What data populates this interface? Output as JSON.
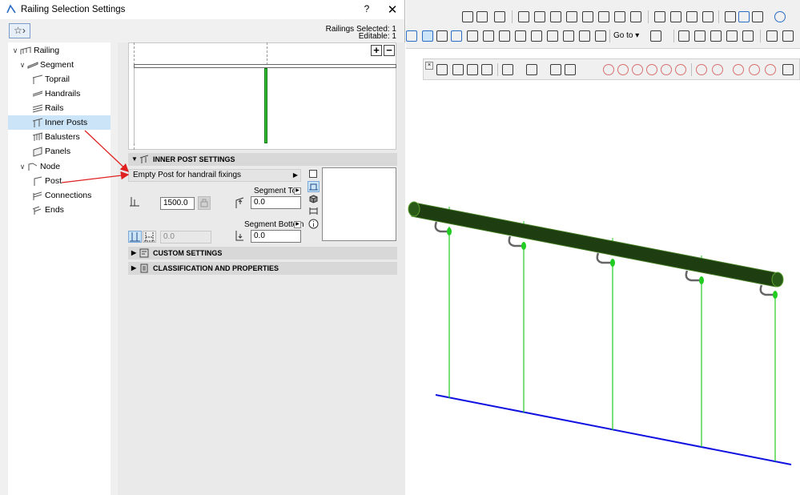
{
  "dialog": {
    "title": "Railing Selection Settings",
    "help": "?",
    "close": "✕",
    "favorites_icon": "favorites-icon",
    "railings_selected": "Railings Selected: 1",
    "editable": "Editable: 1"
  },
  "tree": {
    "items": [
      {
        "label": "Railing",
        "level": 0,
        "expand": "∨"
      },
      {
        "label": "Segment",
        "level": 1,
        "expand": "∨"
      },
      {
        "label": "Toprail",
        "level": 2
      },
      {
        "label": "Handrails",
        "level": 2
      },
      {
        "label": "Rails",
        "level": 2
      },
      {
        "label": "Inner Posts",
        "level": 2,
        "selected": true
      },
      {
        "label": "Balusters",
        "level": 2
      },
      {
        "label": "Panels",
        "level": 2
      },
      {
        "label": "Node",
        "level": 1,
        "expand": "∨"
      },
      {
        "label": "Post",
        "level": 2
      },
      {
        "label": "Connections",
        "level": 2
      },
      {
        "label": "Ends",
        "level": 2
      }
    ]
  },
  "preview": {
    "add": "+",
    "remove": "−"
  },
  "inner_post": {
    "header": "INNER POST SETTINGS",
    "preset": "Empty Post for handrail fixings",
    "height_value": "1500.0",
    "segment_top_label": "Segment Top",
    "segment_top_value": "0.0",
    "segment_bottom_label": "Segment Bottom",
    "segment_bottom_value": "0.0",
    "offset_value": "0.0"
  },
  "custom": {
    "header": "CUSTOM SETTINGS"
  },
  "classification": {
    "header": "CLASSIFICATION AND PROPERTIES"
  },
  "toolbar": {
    "goto_label": "Go to"
  },
  "colors": {
    "selection": "#cce4f7",
    "arrow_red": "#e02020",
    "rail_dark_green": "#1e3d10",
    "post_green": "#22cc22",
    "base_blue": "#1010e0"
  }
}
